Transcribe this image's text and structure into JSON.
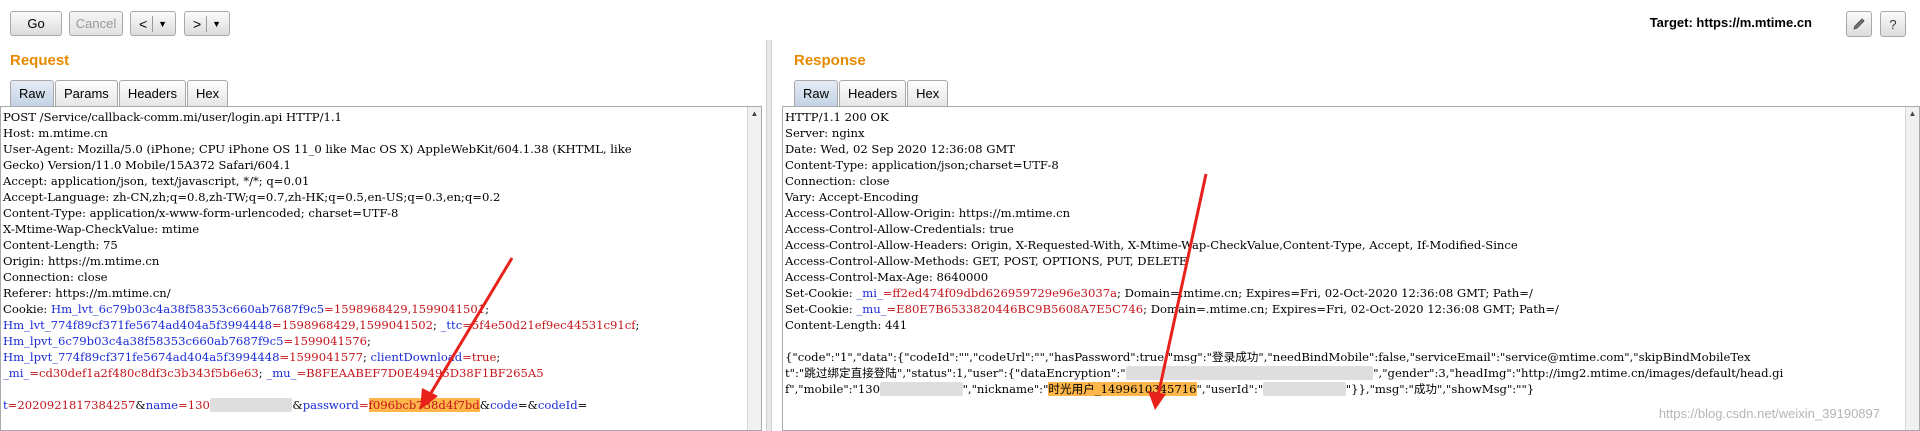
{
  "toolbar": {
    "go_label": "Go",
    "cancel_label": "Cancel",
    "back_glyph": "<",
    "forward_glyph": ">",
    "caret_glyph": "▼",
    "target_label": "Target: ",
    "target_url": "https://m.mtime.cn",
    "edit_icon": "pencil-icon",
    "help_icon": "help-icon"
  },
  "request": {
    "title": "Request",
    "tabs": [
      "Raw",
      "Params",
      "Headers",
      "Hex"
    ],
    "active_tab": "Raw",
    "lines": [
      [
        {
          "t": "POST /Service/callback-comm.mi/user/login.api HTTP/1.1"
        }
      ],
      [
        {
          "t": "Host: m.mtime.cn"
        }
      ],
      [
        {
          "t": "User-Agent: Mozilla/5.0 (iPhone; CPU iPhone OS 11_0 like Mac OS X) AppleWebKit/604.1.38 (KHTML, like"
        }
      ],
      [
        {
          "t": "Gecko) Version/11.0 Mobile/15A372 Safari/604.1"
        }
      ],
      [
        {
          "t": "Accept: application/json, text/javascript, */*; q=0.01"
        }
      ],
      [
        {
          "t": "Accept-Language: zh-CN,zh;q=0.8,zh-TW;q=0.7,zh-HK;q=0.5,en-US;q=0.3,en;q=0.2"
        }
      ],
      [
        {
          "t": "Content-Type: application/x-www-form-urlencoded; charset=UTF-8"
        }
      ],
      [
        {
          "t": "X-Mtime-Wap-CheckValue: mtime"
        }
      ],
      [
        {
          "t": "Content-Length: 75"
        }
      ],
      [
        {
          "t": "Origin: https://m.mtime.cn"
        }
      ],
      [
        {
          "t": "Connection: close"
        }
      ],
      [
        {
          "t": "Referer: https://m.mtime.cn/"
        }
      ],
      [
        {
          "t": "Cookie: "
        },
        {
          "t": "Hm_lvt_6c79b03c4a38f58353c660ab7687f9c5",
          "c": "blue"
        },
        {
          "t": "=1598968429,1599041501",
          "c": "red"
        },
        {
          "t": ";"
        }
      ],
      [
        {
          "t": "Hm_lvt_774f89cf371fe5674ad404a5f3994448",
          "c": "blue"
        },
        {
          "t": "=1598968429,1599041502",
          "c": "red"
        },
        {
          "t": "; "
        },
        {
          "t": "_ttc",
          "c": "blue"
        },
        {
          "t": "=5f4e50d21ef9ec44531c91cf",
          "c": "red"
        },
        {
          "t": ";"
        }
      ],
      [
        {
          "t": "Hm_lpvt_6c79b03c4a38f58353c660ab7687f9c5",
          "c": "blue"
        },
        {
          "t": "=1599041576",
          "c": "red"
        },
        {
          "t": ";"
        }
      ],
      [
        {
          "t": "Hm_lpvt_774f89cf371fe5674ad404a5f3994448",
          "c": "blue"
        },
        {
          "t": "=1599041577",
          "c": "red"
        },
        {
          "t": "; "
        },
        {
          "t": "clientDownload",
          "c": "blue"
        },
        {
          "t": "=true",
          "c": "red"
        },
        {
          "t": ";"
        }
      ],
      [
        {
          "t": "_mi_",
          "c": "blue"
        },
        {
          "t": "=cd30def1a2f480c8df3c3b343f5b6e63",
          "c": "red"
        },
        {
          "t": "; "
        },
        {
          "t": "_mu_",
          "c": "blue"
        },
        {
          "t": "=B8FEAABEF7D0E4949",
          "c": "red"
        },
        {
          "t": "5D38F1BF265A5",
          "c": "red"
        }
      ],
      [
        {
          "t": ""
        }
      ],
      [
        {
          "t": "t",
          "c": "blue"
        },
        {
          "t": "=2020921817384257",
          "c": "red"
        },
        {
          "t": "&"
        },
        {
          "t": "name",
          "c": "blue"
        },
        {
          "t": "=130",
          "c": "red"
        },
        {
          "t": "XXXXXXXXXX",
          "c": "blur"
        },
        {
          "t": "&"
        },
        {
          "t": "password",
          "c": "blue"
        },
        {
          "t": "=",
          "c": "red"
        },
        {
          "t": "f096bcb738d4f7bd",
          "c": "red hl"
        },
        {
          "t": "&"
        },
        {
          "t": "code",
          "c": "blue"
        },
        {
          "t": "=&"
        },
        {
          "t": "codeId",
          "c": "blue"
        },
        {
          "t": "="
        }
      ]
    ]
  },
  "response": {
    "title": "Response",
    "tabs": [
      "Raw",
      "Headers",
      "Hex"
    ],
    "active_tab": "Raw",
    "lines": [
      [
        {
          "t": "HTTP/1.1 200 OK"
        }
      ],
      [
        {
          "t": "Server: nginx"
        }
      ],
      [
        {
          "t": "Date: Wed, 02 Sep 2020 12:36:08 GMT"
        }
      ],
      [
        {
          "t": "Content-Type: application/json;charset=UTF-8"
        }
      ],
      [
        {
          "t": "Connection: close"
        }
      ],
      [
        {
          "t": "Vary: Accept-Encoding"
        }
      ],
      [
        {
          "t": "Access-Control-Allow-Origin: https://m.mtime.cn"
        }
      ],
      [
        {
          "t": "Access-Control-Allow-Credentials: true"
        }
      ],
      [
        {
          "t": "Access-Control-Allow-Headers: Origin, X-Requested-With, X-Mtime-Wap-CheckValue,Content-Type, Accept, If-Modified-Since"
        }
      ],
      [
        {
          "t": "Access-Control-Allow-Methods: GET, POST, OPTIONS, PUT, DELETE"
        }
      ],
      [
        {
          "t": "Access-Control-Max-Age: 8640000"
        }
      ],
      [
        {
          "t": "Set-Cookie: "
        },
        {
          "t": "_mi_",
          "c": "blue"
        },
        {
          "t": "=ff2ed474f09dbd626959729e96e3037a",
          "c": "red"
        },
        {
          "t": "; Domain=.mtime.cn; Expires=Fri, 02-Oct-2020 12:36:08 GMT; Path=/"
        }
      ],
      [
        {
          "t": "Set-Cookie: "
        },
        {
          "t": "_mu_",
          "c": "blue"
        },
        {
          "t": "=E80E7B6533820446BC9B5608A7E5C746",
          "c": "red"
        },
        {
          "t": "; Domain=.mtime.cn; Expires=Fri, 02-Oct-2020 12:36:08 GMT; Path=/"
        }
      ],
      [
        {
          "t": "Content-Length: 441"
        }
      ],
      [
        {
          "t": ""
        }
      ],
      [
        {
          "t": "{\"code\":\"1\",\"data\":{\"codeId\":\"\",\"codeUrl\":\"\",\"hasPassword\":true,\"msg\":\"登录成功\",\"needBindMobile\":false,\"serviceEmail\":\"service@mtime.com\",\"skipBindMobileTex"
        }
      ],
      [
        {
          "t": "t\":\"跳过绑定直接登陆\",\"status\":1,\"user\":{\"dataEncryption\":\""
        },
        {
          "t": "XXXXXXXXXXXXXXXXXXXXXXXXXXXXXX",
          "c": "blur"
        },
        {
          "t": "\",\"gender\":3,\"headImg\":\"http://img2.mtime.cn/images/default/head.gi"
        }
      ],
      [
        {
          "t": "f\",\"mobile\":\"130"
        },
        {
          "t": "XXXXXXXXXX",
          "c": "blur"
        },
        {
          "t": "\",\"nickname\":\""
        },
        {
          "t": "时光用户_1499610345716",
          "c": "hl"
        },
        {
          "t": "\",\"userId\":\""
        },
        {
          "t": "XXXXXXXXXX",
          "c": "blur"
        },
        {
          "t": "\"}},\"msg\":\"成功\",\"showMsg\":\"\"}"
        }
      ]
    ]
  },
  "watermark": "https://blog.csdn.net/weixin_39190897"
}
